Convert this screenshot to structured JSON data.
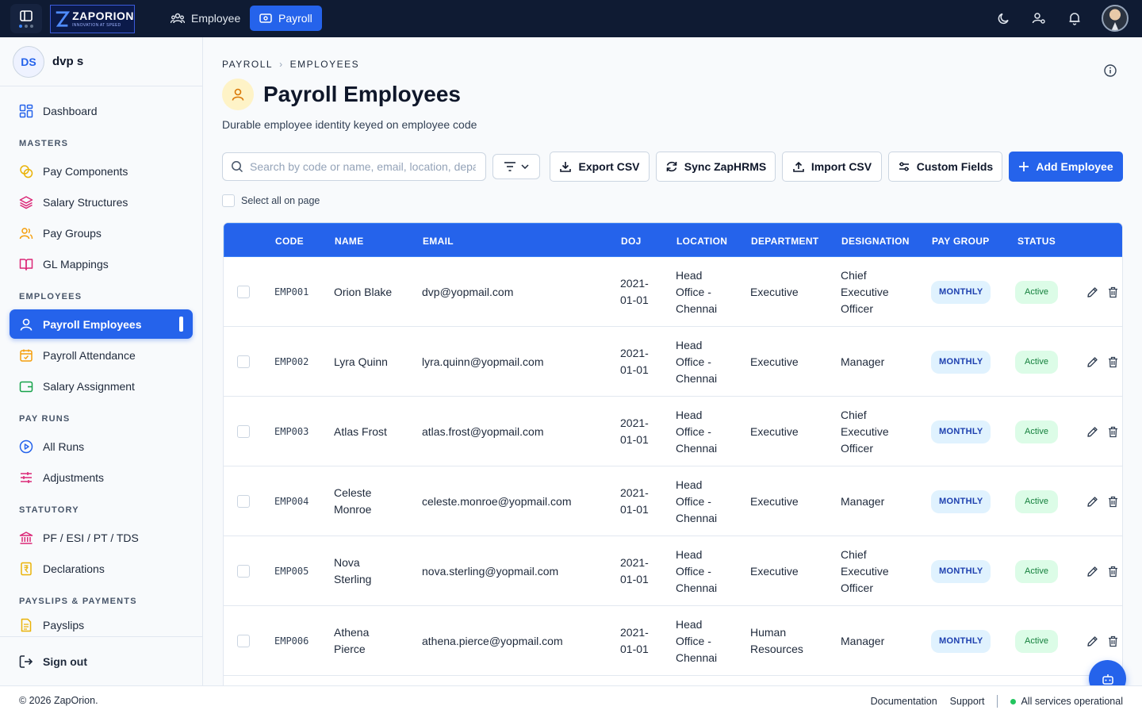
{
  "topbar": {
    "logo_text": "ZAPORION",
    "logo_tagline": "INNOVATION AT SPEED",
    "tabs": [
      {
        "label": "Employee",
        "icon": "people-icon"
      },
      {
        "label": "Payroll",
        "icon": "payroll-icon",
        "active": true
      }
    ],
    "icons": [
      "panel-icon",
      "moon-icon",
      "user-settings-icon",
      "bell-icon",
      "user-avatar"
    ]
  },
  "user": {
    "initials": "DS",
    "name": "dvp s"
  },
  "sidebar": {
    "dashboard": "Dashboard",
    "sections": {
      "masters": "MASTERS",
      "employees": "EMPLOYEES",
      "pay_runs": "PAY RUNS",
      "statutory": "STATUTORY",
      "payslips": "PAYSLIPS & PAYMENTS"
    },
    "items": {
      "pay_components": "Pay Components",
      "salary_structures": "Salary Structures",
      "pay_groups": "Pay Groups",
      "gl_mappings": "GL Mappings",
      "payroll_employees": "Payroll Employees",
      "payroll_attendance": "Payroll Attendance",
      "salary_assignment": "Salary Assignment",
      "all_runs": "All Runs",
      "adjustments": "Adjustments",
      "pf_esi": "PF / ESI / PT / TDS",
      "declarations": "Declarations",
      "payslips": "Payslips"
    },
    "sign_out": "Sign out"
  },
  "page": {
    "breadcrumb": [
      "PAYROLL",
      "EMPLOYEES"
    ],
    "title": "Payroll Employees",
    "subtitle": "Durable employee identity keyed on employee code",
    "search_placeholder": "Search by code or name, email, location, department",
    "select_all_label": "Select all on page"
  },
  "toolbar": {
    "export_csv": "Export CSV",
    "sync": "Sync ZapHRMS",
    "import_csv": "Import CSV",
    "custom_fields": "Custom Fields",
    "add_employee": "Add Employee"
  },
  "table": {
    "columns": [
      "CODE",
      "NAME",
      "EMAIL",
      "DOJ",
      "LOCATION",
      "DEPARTMENT",
      "DESIGNATION",
      "PAY GROUP",
      "STATUS"
    ],
    "rows": [
      {
        "code": "EMP001",
        "name": "Orion Blake",
        "email": "dvp@yopmail.com",
        "doj": "2021-01-01",
        "location": "Head Office - Chennai",
        "department": "Executive",
        "designation": "Chief Executive Officer",
        "pay_group": "MONTHLY",
        "status": "Active"
      },
      {
        "code": "EMP002",
        "name": "Lyra Quinn",
        "email": "lyra.quinn@yopmail.com",
        "doj": "2021-01-01",
        "location": "Head Office - Chennai",
        "department": "Executive",
        "designation": "Manager",
        "pay_group": "MONTHLY",
        "status": "Active"
      },
      {
        "code": "EMP003",
        "name": "Atlas Frost",
        "email": "atlas.frost@yopmail.com",
        "doj": "2021-01-01",
        "location": "Head Office - Chennai",
        "department": "Executive",
        "designation": "Chief Executive Officer",
        "pay_group": "MONTHLY",
        "status": "Active"
      },
      {
        "code": "EMP004",
        "name": "Celeste Monroe",
        "email": "celeste.monroe@yopmail.com",
        "doj": "2021-01-01",
        "location": "Head Office - Chennai",
        "department": "Executive",
        "designation": "Manager",
        "pay_group": "MONTHLY",
        "status": "Active"
      },
      {
        "code": "EMP005",
        "name": "Nova Sterling",
        "email": "nova.sterling@yopmail.com",
        "doj": "2021-01-01",
        "location": "Head Office - Chennai",
        "department": "Executive",
        "designation": "Chief Executive Officer",
        "pay_group": "MONTHLY",
        "status": "Active"
      },
      {
        "code": "EMP006",
        "name": "Athena Pierce",
        "email": "athena.pierce@yopmail.com",
        "doj": "2021-01-01",
        "location": "Head Office - Chennai",
        "department": "Human Resources",
        "designation": "Manager",
        "pay_group": "MONTHLY",
        "status": "Active"
      }
    ]
  },
  "footer": {
    "copyright": "© 2026 ZapOrion.",
    "documentation": "Documentation",
    "support": "Support",
    "status": "All services operational"
  },
  "colors": {
    "primary": "#2563eb",
    "topbar": "#0f1b33",
    "active_badge": "#dcfce7",
    "paygroup_badge": "#e0f2fe"
  }
}
